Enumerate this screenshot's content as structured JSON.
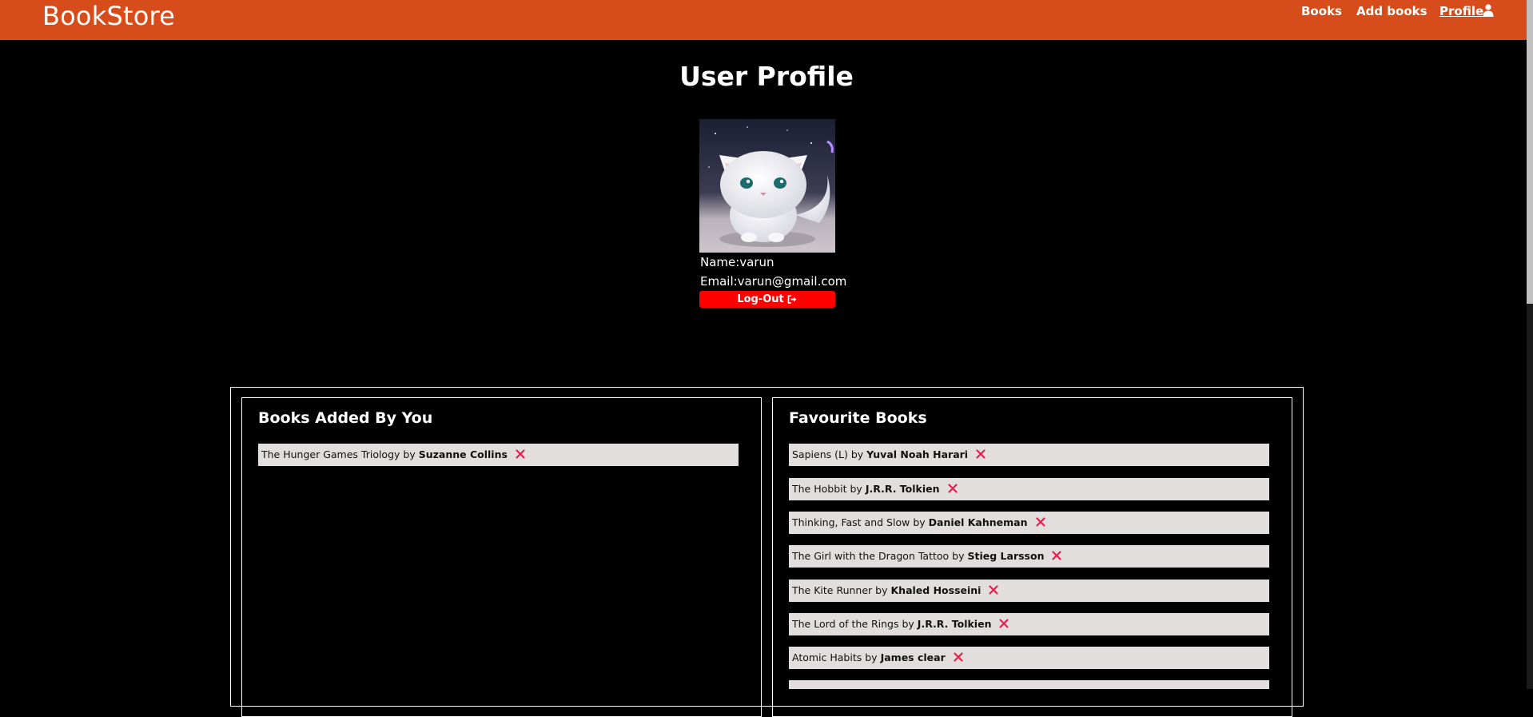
{
  "navbar": {
    "brand": "BookStore",
    "links": {
      "books": "Books",
      "add_books": "Add books",
      "profile": "Profile"
    },
    "color": "#d64d1b"
  },
  "profile": {
    "title": "User Profile",
    "avatar_alt": "cat-avatar",
    "name": "Name:varun",
    "email": "Email:varun@gmail.com",
    "logout_label": "Log-Out",
    "logout_color": "#ff0000"
  },
  "added_books": {
    "heading": "Books Added By You",
    "items": [
      {
        "title": "The Hunger Games Triology",
        "author": "Suzanne Collins"
      }
    ]
  },
  "favourite_books": {
    "heading": "Favourite Books",
    "items": [
      {
        "title": "Sapiens (L)",
        "author": "Yuval Noah Harari"
      },
      {
        "title": "The Hobbit",
        "author": "J.R.R. Tolkien"
      },
      {
        "title": "Thinking, Fast and Slow",
        "author": "Daniel Kahneman"
      },
      {
        "title": "The Girl with the Dragon Tattoo",
        "author": "Stieg Larsson"
      },
      {
        "title": "The Kite Runner",
        "author": "Khaled Hosseini"
      },
      {
        "title": "The Lord of the Rings",
        "author": "J.R.R. Tolkien"
      },
      {
        "title": "Atomic Habits",
        "author": "James clear"
      }
    ]
  },
  "book_by_word": "by",
  "icons": {
    "user": "user-icon",
    "logout": "sign-out-icon",
    "remove": "close-icon"
  },
  "remove_icon_color": "#e8204a"
}
